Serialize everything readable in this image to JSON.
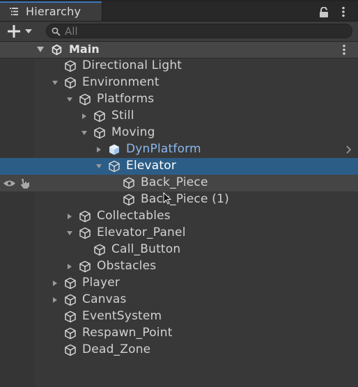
{
  "window": {
    "tab_title": "Hierarchy"
  },
  "toolbar": {
    "search_placeholder": "All"
  },
  "scene": {
    "name": "Main"
  },
  "colors": {
    "selection": "#2c5d87",
    "prefab_text": "#8ab8f0",
    "tab_accent": "#3a79bb",
    "background": "#383838"
  },
  "tree": [
    {
      "label": "Directional Light",
      "depth": 0,
      "expand": "none",
      "selected": false,
      "prefab": false
    },
    {
      "label": "Environment",
      "depth": 0,
      "expand": "open",
      "selected": false,
      "prefab": false
    },
    {
      "label": "Platforms",
      "depth": 1,
      "expand": "open",
      "selected": false,
      "prefab": false
    },
    {
      "label": "Still",
      "depth": 2,
      "expand": "closed",
      "selected": false,
      "prefab": false
    },
    {
      "label": "Moving",
      "depth": 2,
      "expand": "open",
      "selected": false,
      "prefab": false
    },
    {
      "label": "DynPlatform",
      "depth": 3,
      "expand": "closed",
      "selected": false,
      "prefab": true
    },
    {
      "label": "Elevator",
      "depth": 3,
      "expand": "open",
      "selected": true,
      "prefab": false
    },
    {
      "label": "Back_Piece",
      "depth": 4,
      "expand": "none",
      "selected": false,
      "prefab": false
    },
    {
      "label": "Back_Piece (1)",
      "depth": 4,
      "expand": "none",
      "selected": false,
      "prefab": false
    },
    {
      "label": "Collectables",
      "depth": 1,
      "expand": "closed",
      "selected": false,
      "prefab": false
    },
    {
      "label": "Elevator_Panel",
      "depth": 1,
      "expand": "open",
      "selected": false,
      "prefab": false
    },
    {
      "label": "Call_Button",
      "depth": 2,
      "expand": "none",
      "selected": false,
      "prefab": false
    },
    {
      "label": "Obstacles",
      "depth": 1,
      "expand": "closed",
      "selected": false,
      "prefab": false
    },
    {
      "label": "Player",
      "depth": 0,
      "expand": "closed",
      "selected": false,
      "prefab": false
    },
    {
      "label": "Canvas",
      "depth": 0,
      "expand": "closed",
      "selected": false,
      "prefab": false
    },
    {
      "label": "EventSystem",
      "depth": 0,
      "expand": "none",
      "selected": false,
      "prefab": false
    },
    {
      "label": "Respawn_Point",
      "depth": 0,
      "expand": "none",
      "selected": false,
      "prefab": false
    },
    {
      "label": "Dead_Zone",
      "depth": 0,
      "expand": "none",
      "selected": false,
      "prefab": false
    }
  ],
  "icons": {
    "tab": "hierarchy-list-icon",
    "lock": "lock-icon",
    "menu": "kebab-menu-icon",
    "add": "plus-dropdown-icon",
    "search": "search-icon",
    "scene": "unity-logo-icon",
    "object": "cube-icon",
    "prefab": "prefab-cube-icon",
    "visibility": "eye-icon",
    "pickable": "hand-pointer-icon"
  }
}
